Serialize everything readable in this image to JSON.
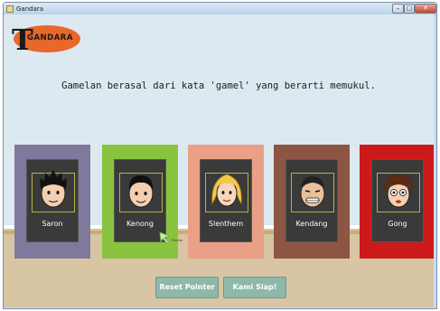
{
  "window": {
    "title": "Gandara",
    "minimize_glyph": "–",
    "maximize_glyph": "□",
    "close_glyph": "✕"
  },
  "logo": {
    "text": "GANDARA",
    "initial": "T",
    "colors": {
      "ellipse": "#e8682a",
      "text": "#1a1a1a"
    }
  },
  "sentence": "Gamelan berasal dari kata 'gamel' yang berarti memukul.",
  "cards": [
    {
      "name": "Saron",
      "bg": "#7f7a9b",
      "hair": "dark-spiky"
    },
    {
      "name": "Kenong",
      "bg": "#88c43f",
      "hair": "dark-short"
    },
    {
      "name": "Slenthem",
      "bg": "#e9a087",
      "hair": "blonde-curly"
    },
    {
      "name": "Kendang",
      "bg": "#8c5544",
      "hair": "buzz-grin"
    },
    {
      "name": "Gong",
      "bg": "#cc1a1a",
      "hair": "brown-bob"
    }
  ],
  "pointer": {
    "icon": "pointer-arrow-icon",
    "caption": "Pointer"
  },
  "buttons": {
    "reset": "Reset Pointer",
    "siap": "Kami Siap!"
  },
  "colors": {
    "sky": "#dde9f1",
    "floor": "#d8c5a3",
    "button": "#8fb8ac"
  }
}
